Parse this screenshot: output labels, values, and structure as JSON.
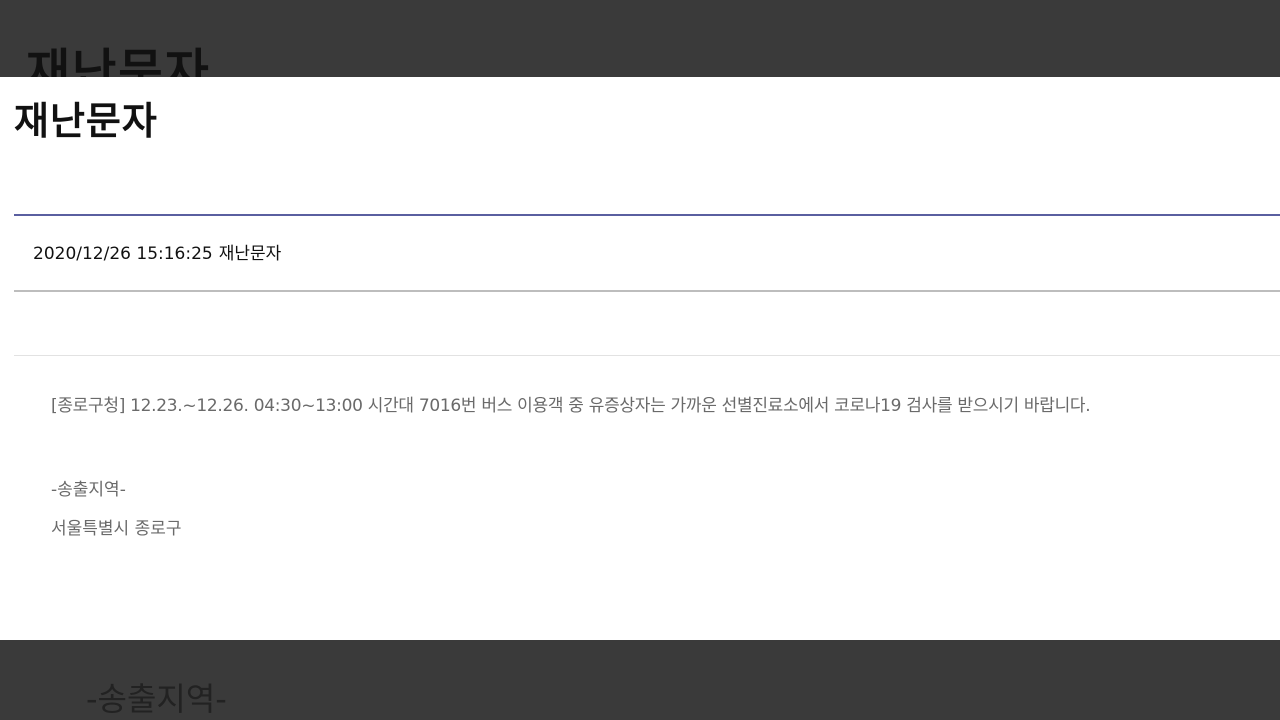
{
  "backdrop": {
    "title": "재난문자",
    "region_label": "-송출지역-"
  },
  "page": {
    "title": "재난문자"
  },
  "meta": {
    "datetime": "2020/12/26 15:16:25",
    "category": "재난문자"
  },
  "message": {
    "text": "[종로구청] 12.23.~12.26. 04:30~13:00 시간대 7016번 버스 이용객 중 유증상자는 가까운 선별진료소에서 코로나19 검사를 받으시기 바랍니다.",
    "region_label": "-송출지역-",
    "region": "서울특별시 종로구"
  },
  "colors": {
    "accent_rule": "#5a5fa0",
    "overlay": "#3a3a3a"
  }
}
